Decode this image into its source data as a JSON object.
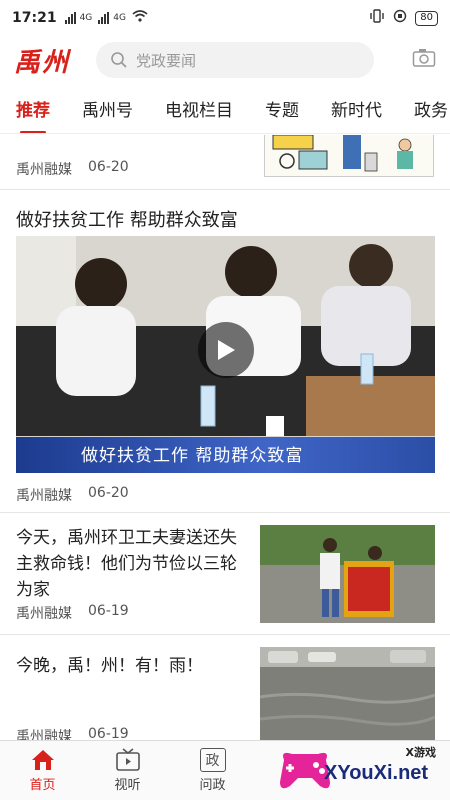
{
  "status_bar": {
    "time": "17:21",
    "sig1": "4G",
    "sig2": "4G",
    "battery": "80"
  },
  "header": {
    "logo": "禹州",
    "search_placeholder": "党政要闻",
    "brand_color": "#d9211c"
  },
  "tabs": [
    {
      "label": "推荐",
      "active": true
    },
    {
      "label": "禹州号",
      "active": false
    },
    {
      "label": "电视栏目",
      "active": false
    },
    {
      "label": "专题",
      "active": false
    },
    {
      "label": "新时代",
      "active": false
    },
    {
      "label": "政务",
      "active": false
    }
  ],
  "feed": [
    {
      "source": "禹州融媒",
      "date": "06-20"
    },
    {
      "title": "做好扶贫工作 帮助群众致富",
      "video_caption": "做好扶贫工作  帮助群众致富",
      "source": "禹州融媒",
      "date": "06-20"
    },
    {
      "title": "今天，禹州环卫工夫妻送还失主救命钱！他们为节俭以三轮为家",
      "source": "禹州融媒",
      "date": "06-19"
    },
    {
      "title": "今晚，禹！州！有！雨！",
      "source": "禹州融媒",
      "date": "06-19"
    }
  ],
  "bottom_nav": [
    {
      "label": "首页",
      "icon": "home-icon",
      "active": true
    },
    {
      "label": "视听",
      "icon": "tv-icon",
      "active": false
    },
    {
      "label": "问政",
      "icon_text": "政",
      "icon": "politics-icon",
      "active": false
    }
  ],
  "watermark": {
    "text": "XYouXi.net",
    "top_text": "X游戏"
  }
}
